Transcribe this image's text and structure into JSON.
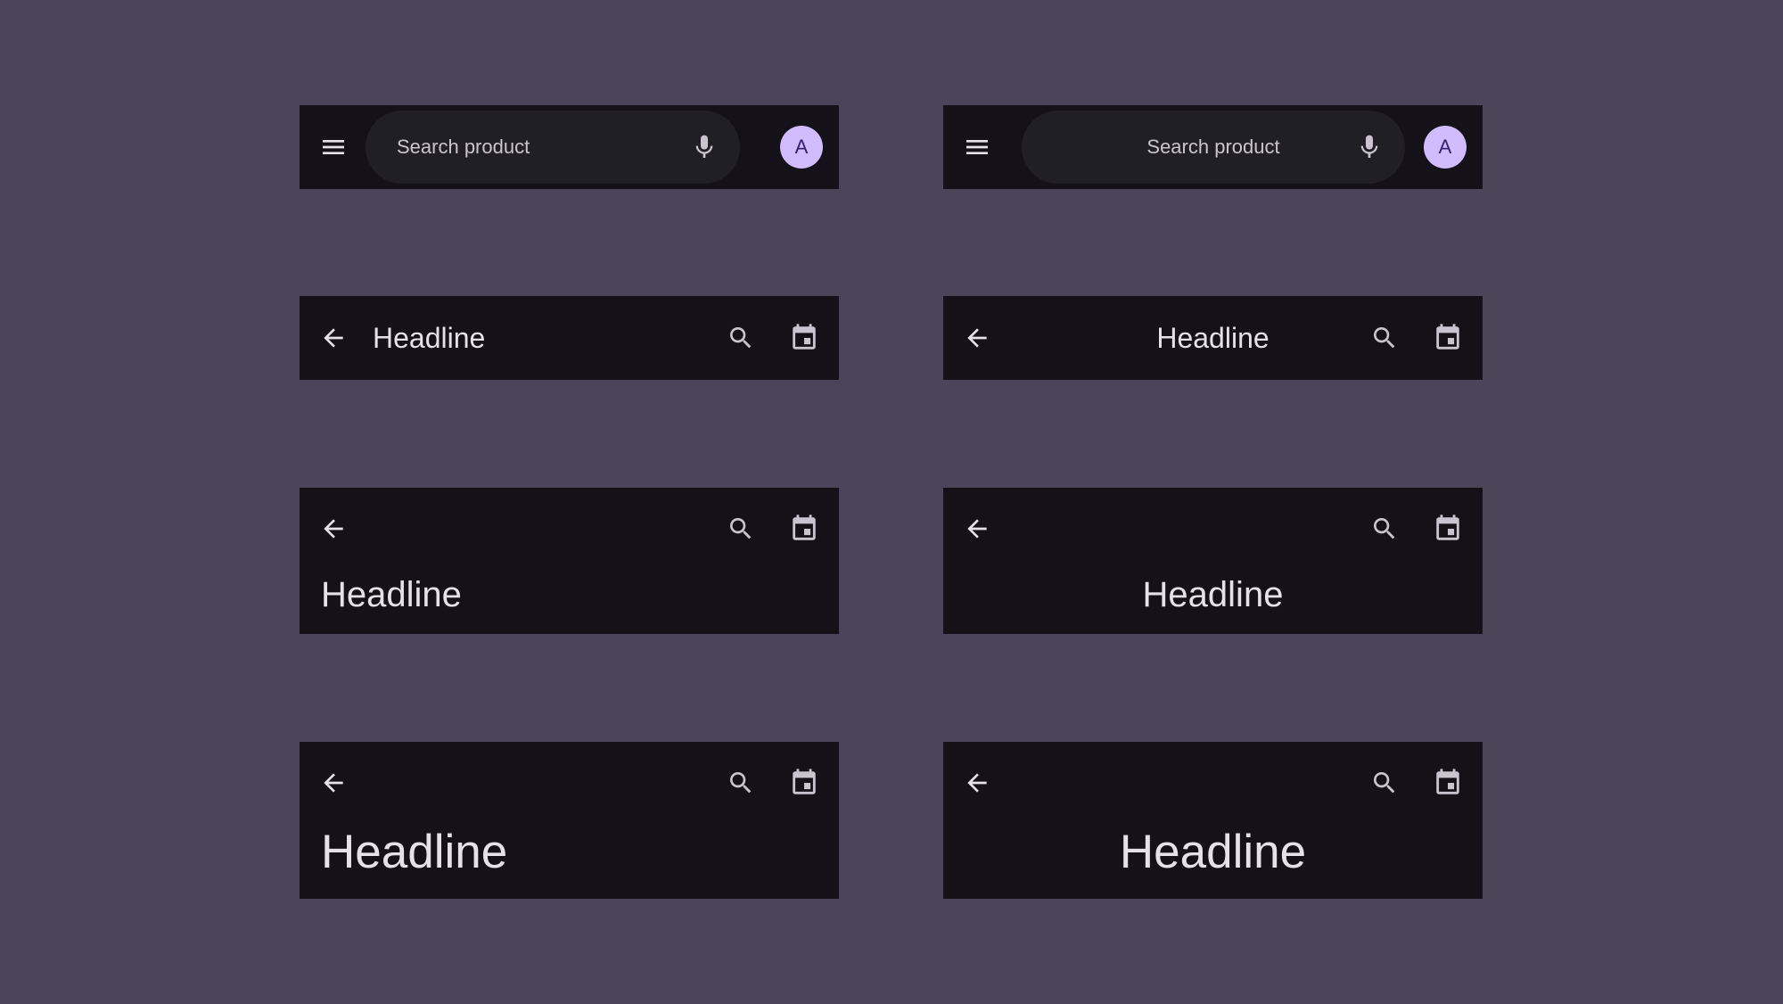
{
  "colors": {
    "background": "#4a4559",
    "app_bar": "#141218",
    "search_field": "#211f26",
    "icon": "#e6e0e9",
    "on_surface_variant": "#cac4d0",
    "avatar_bg": "#d0bcff",
    "avatar_fg": "#381e72"
  },
  "search_bars": [
    {
      "alignment": "left",
      "leading_icon": "menu-icon",
      "placeholder": "Search product",
      "trailing_icon": "mic-icon",
      "avatar_letter": "A"
    },
    {
      "alignment": "center",
      "leading_icon": "menu-icon",
      "placeholder": "Search product",
      "trailing_icon": "mic-icon",
      "avatar_letter": "A"
    }
  ],
  "small_bars": [
    {
      "alignment": "left",
      "headline": "Headline",
      "icons": [
        "arrow-back-icon",
        "search-icon",
        "calendar-icon"
      ]
    },
    {
      "alignment": "center",
      "headline": "Headline",
      "icons": [
        "arrow-back-icon",
        "search-icon",
        "calendar-icon"
      ]
    }
  ],
  "medium_bars": [
    {
      "alignment": "left",
      "headline": "Headline",
      "icons": [
        "arrow-back-icon",
        "search-icon",
        "calendar-icon"
      ]
    },
    {
      "alignment": "center",
      "headline": "Headline",
      "icons": [
        "arrow-back-icon",
        "search-icon",
        "calendar-icon"
      ]
    }
  ],
  "large_bars": [
    {
      "alignment": "left",
      "headline": "Headline",
      "icons": [
        "arrow-back-icon",
        "search-icon",
        "calendar-icon"
      ]
    },
    {
      "alignment": "center",
      "headline": "Headline",
      "icons": [
        "arrow-back-icon",
        "search-icon",
        "calendar-icon"
      ]
    }
  ]
}
